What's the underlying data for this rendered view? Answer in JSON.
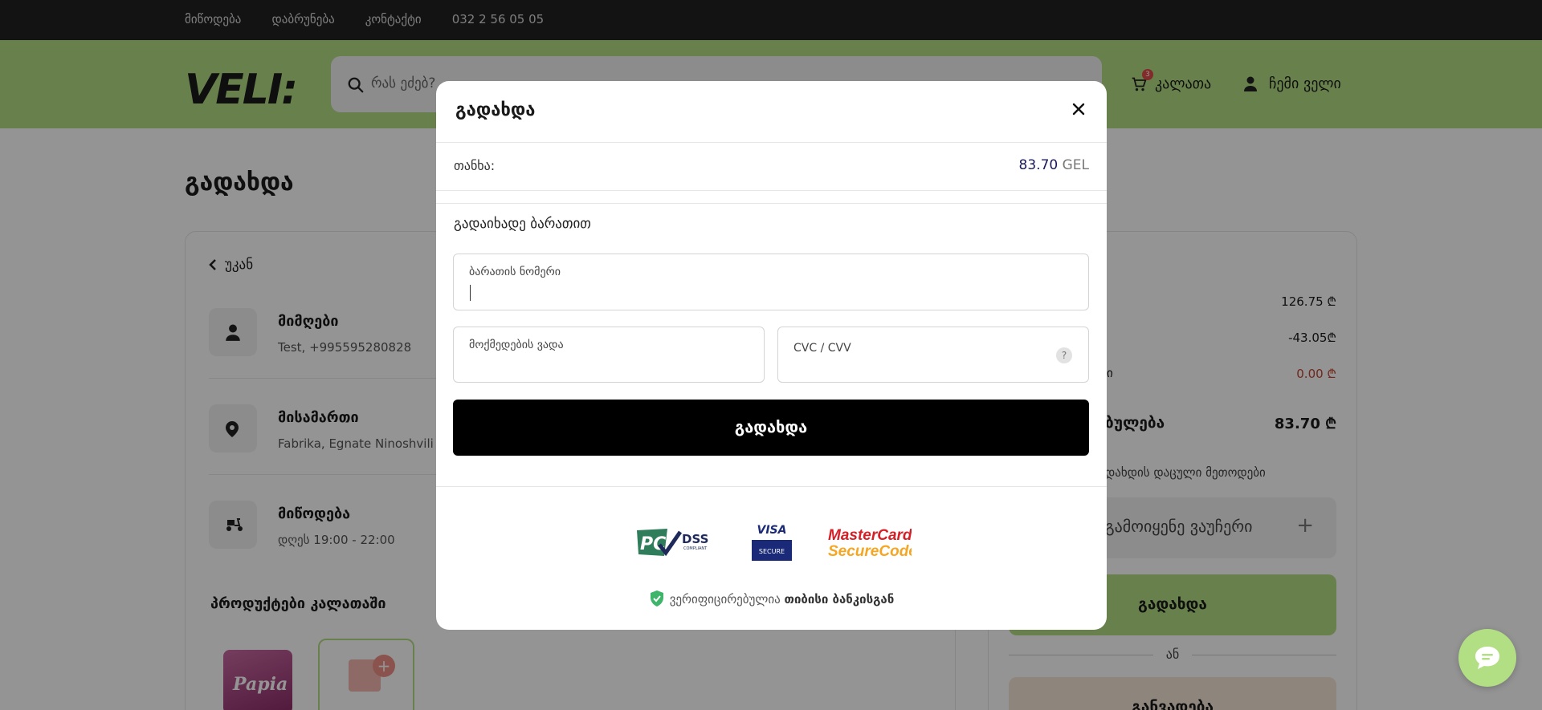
{
  "topbar": {
    "links": [
      "მიწოდება",
      "დაბრუნება",
      "კონტაქტი"
    ],
    "phone": "032 2 56 05 05"
  },
  "header": {
    "logo": "VELI:",
    "search_placeholder": "რას ეძებ?",
    "cart_label": "კალათა",
    "cart_count": "3",
    "profile_label": "ჩემი ველი",
    "accent_color": "#b3df84"
  },
  "page": {
    "title": "გადახდა",
    "back_label": "უკან",
    "receiver": {
      "title": "მიმღები",
      "value": "Test, +995595280828"
    },
    "address": {
      "title": "მისამართი",
      "value": "Fabrika, Egnate Ninoshvili St"
    },
    "delivery": {
      "title": "მიწოდება",
      "value": "დღეს  19:00 - 22:00"
    },
    "products_title": "პროდუქტები კალათაში",
    "product_brand": "Papia"
  },
  "summary": {
    "subtotal": "126.75 ₾",
    "discount": "-43.05₾",
    "third_label": "რი",
    "third_value": "0.00 ₾",
    "total_label": "ბულება",
    "total": "83.70 ₾",
    "methods_label": "დახდის დაცული მეთოდები",
    "voucher_label": "გამოიყენე ვაუჩერი",
    "voucher_plus": "+",
    "pay_label": "გადახდა",
    "or_label": "ან",
    "installment_label": "განვადება"
  },
  "modal": {
    "title": "გადახდა",
    "amount_label": "თანხა:",
    "amount_value": "83.70",
    "amount_currency": "GEL",
    "section_title": "გადაიხადე ბარათით",
    "card_number_label": "ბარათის ნომერი",
    "expiry_label": "მოქმედების ვადა",
    "cvc_label": "CVC / CVV",
    "cvc_help": "?",
    "pay_button": "გადახდა",
    "verified_prefix": "ვერიფიცირებულია",
    "verified_bank": "თიბისი ბანკისგან",
    "badges": {
      "pci": "PCI",
      "dss": "DSS",
      "dss_sub": "COMPLIANT",
      "visa": "VISA",
      "visa_sub": "SECURE",
      "mc_line1": "MasterCard.",
      "mc_line2": "SecureCode."
    }
  }
}
